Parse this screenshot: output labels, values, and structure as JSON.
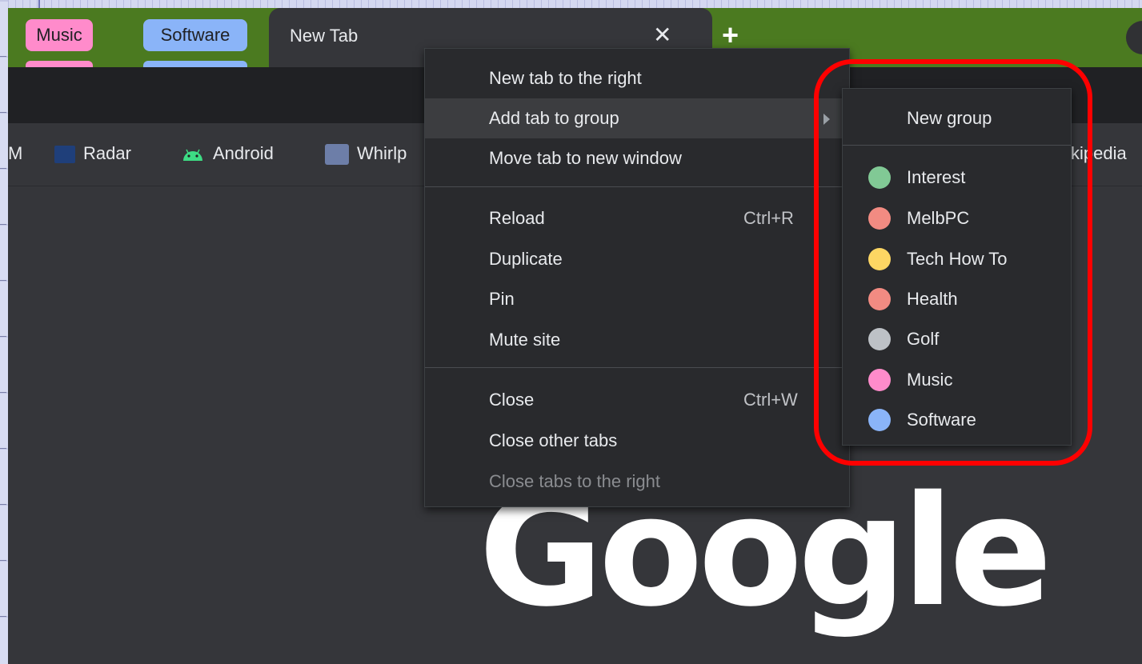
{
  "tab_strip": {
    "groups": [
      {
        "label": "Music",
        "color": "#ff8bcb"
      },
      {
        "label": "Software",
        "color": "#8ab4f8"
      }
    ],
    "active_tab": {
      "title": "New Tab",
      "close_icon": "close-icon"
    },
    "new_tab_icon": "plus-icon"
  },
  "bookmarks": {
    "items": [
      {
        "label": "M"
      },
      {
        "label": "Radar",
        "icon": "radar-icon"
      },
      {
        "label": "Android",
        "icon": "android-icon"
      },
      {
        "label": "Whirlp",
        "icon": "whirlpool-icon"
      },
      {
        "label": "kipedia"
      }
    ]
  },
  "main": {
    "logo_text": "Google"
  },
  "context_menu": {
    "items": [
      {
        "label": "New tab to the right"
      },
      {
        "label": "Add tab to group",
        "has_submenu": true
      },
      {
        "label": "Move tab to new window"
      },
      {
        "label": "Reload",
        "shortcut": "Ctrl+R"
      },
      {
        "label": "Duplicate"
      },
      {
        "label": "Pin"
      },
      {
        "label": "Mute site"
      },
      {
        "label": "Close",
        "shortcut": "Ctrl+W"
      },
      {
        "label": "Close other tabs"
      },
      {
        "label": "Close tabs to the right",
        "disabled": true
      }
    ]
  },
  "group_submenu": {
    "new_group": "New group",
    "groups": [
      {
        "name": "Interest",
        "color": "#81c995"
      },
      {
        "name": "MelbPC",
        "color": "#f28b82"
      },
      {
        "name": "Tech How To",
        "color": "#fdd663"
      },
      {
        "name": "Health",
        "color": "#f28b82"
      },
      {
        "name": "Golf",
        "color": "#bdc1c6"
      },
      {
        "name": "Music",
        "color": "#ff8bcb"
      },
      {
        "name": "Software",
        "color": "#8ab4f8"
      }
    ]
  },
  "highlight_color": "#ff0000"
}
